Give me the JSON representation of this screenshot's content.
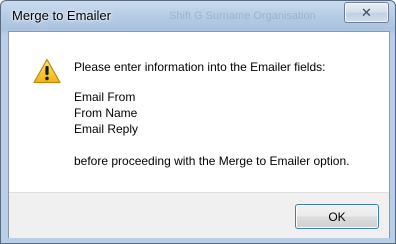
{
  "window": {
    "title": "Merge to Emailer",
    "background_text": "Shift G   Surname   Organisation",
    "close_glyph": "✕"
  },
  "dialog": {
    "icon": "warning-icon",
    "intro": "Please enter information into the Emailer fields:",
    "fields": [
      "Email From",
      "From Name",
      "Email Reply"
    ],
    "outro": "before proceeding with the Merge to Emailer option."
  },
  "buttons": {
    "ok_label": "OK"
  },
  "colors": {
    "title_bar": "#b7cde6",
    "warning_fill": "#f6c41a",
    "ok_border": "#3c7fb1"
  }
}
